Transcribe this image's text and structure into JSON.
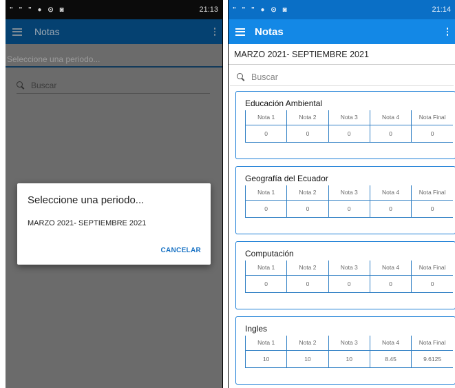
{
  "left_screen": {
    "status": {
      "icons": "\" \" \" ● ⊙ ◙",
      "time": "21:13"
    },
    "toolbar": {
      "title": "Notas"
    },
    "period_input": {
      "placeholder": "Seleccione una periodo..."
    },
    "search": {
      "placeholder": "Buscar"
    },
    "dialog": {
      "title": "Seleccione una periodo...",
      "option": "MARZO 2021- SEPTIEMBRE 2021",
      "cancel_label": "CANCELAR"
    }
  },
  "right_screen": {
    "status": {
      "icons": "\" \" \" ● ⊙ ◙",
      "time": "21:14"
    },
    "toolbar": {
      "title": "Notas"
    },
    "period": "MARZO 2021- SEPTIEMBRE 2021",
    "search": {
      "placeholder": "Buscar"
    },
    "grade_headers": [
      "Nota 1",
      "Nota 2",
      "Nota 3",
      "Nota 4",
      "Nota Final"
    ],
    "subjects": [
      {
        "name": "Educación Ambiental",
        "grades": [
          "0",
          "0",
          "0",
          "0",
          "0"
        ]
      },
      {
        "name": "Geografía del Ecuador",
        "grades": [
          "0",
          "0",
          "0",
          "0",
          "0"
        ]
      },
      {
        "name": "Computación",
        "grades": [
          "0",
          "0",
          "0",
          "0",
          "0"
        ]
      },
      {
        "name": "Ingles",
        "grades": [
          "10",
          "10",
          "10",
          "8.45",
          "9.6125"
        ]
      }
    ]
  },
  "colors": {
    "primary": "#1388e6",
    "primary_dark": "#0a6fc6",
    "dimmed_toolbar": "#054171",
    "card_border": "#1c7ed6",
    "cancel_text": "#1a73c4"
  }
}
